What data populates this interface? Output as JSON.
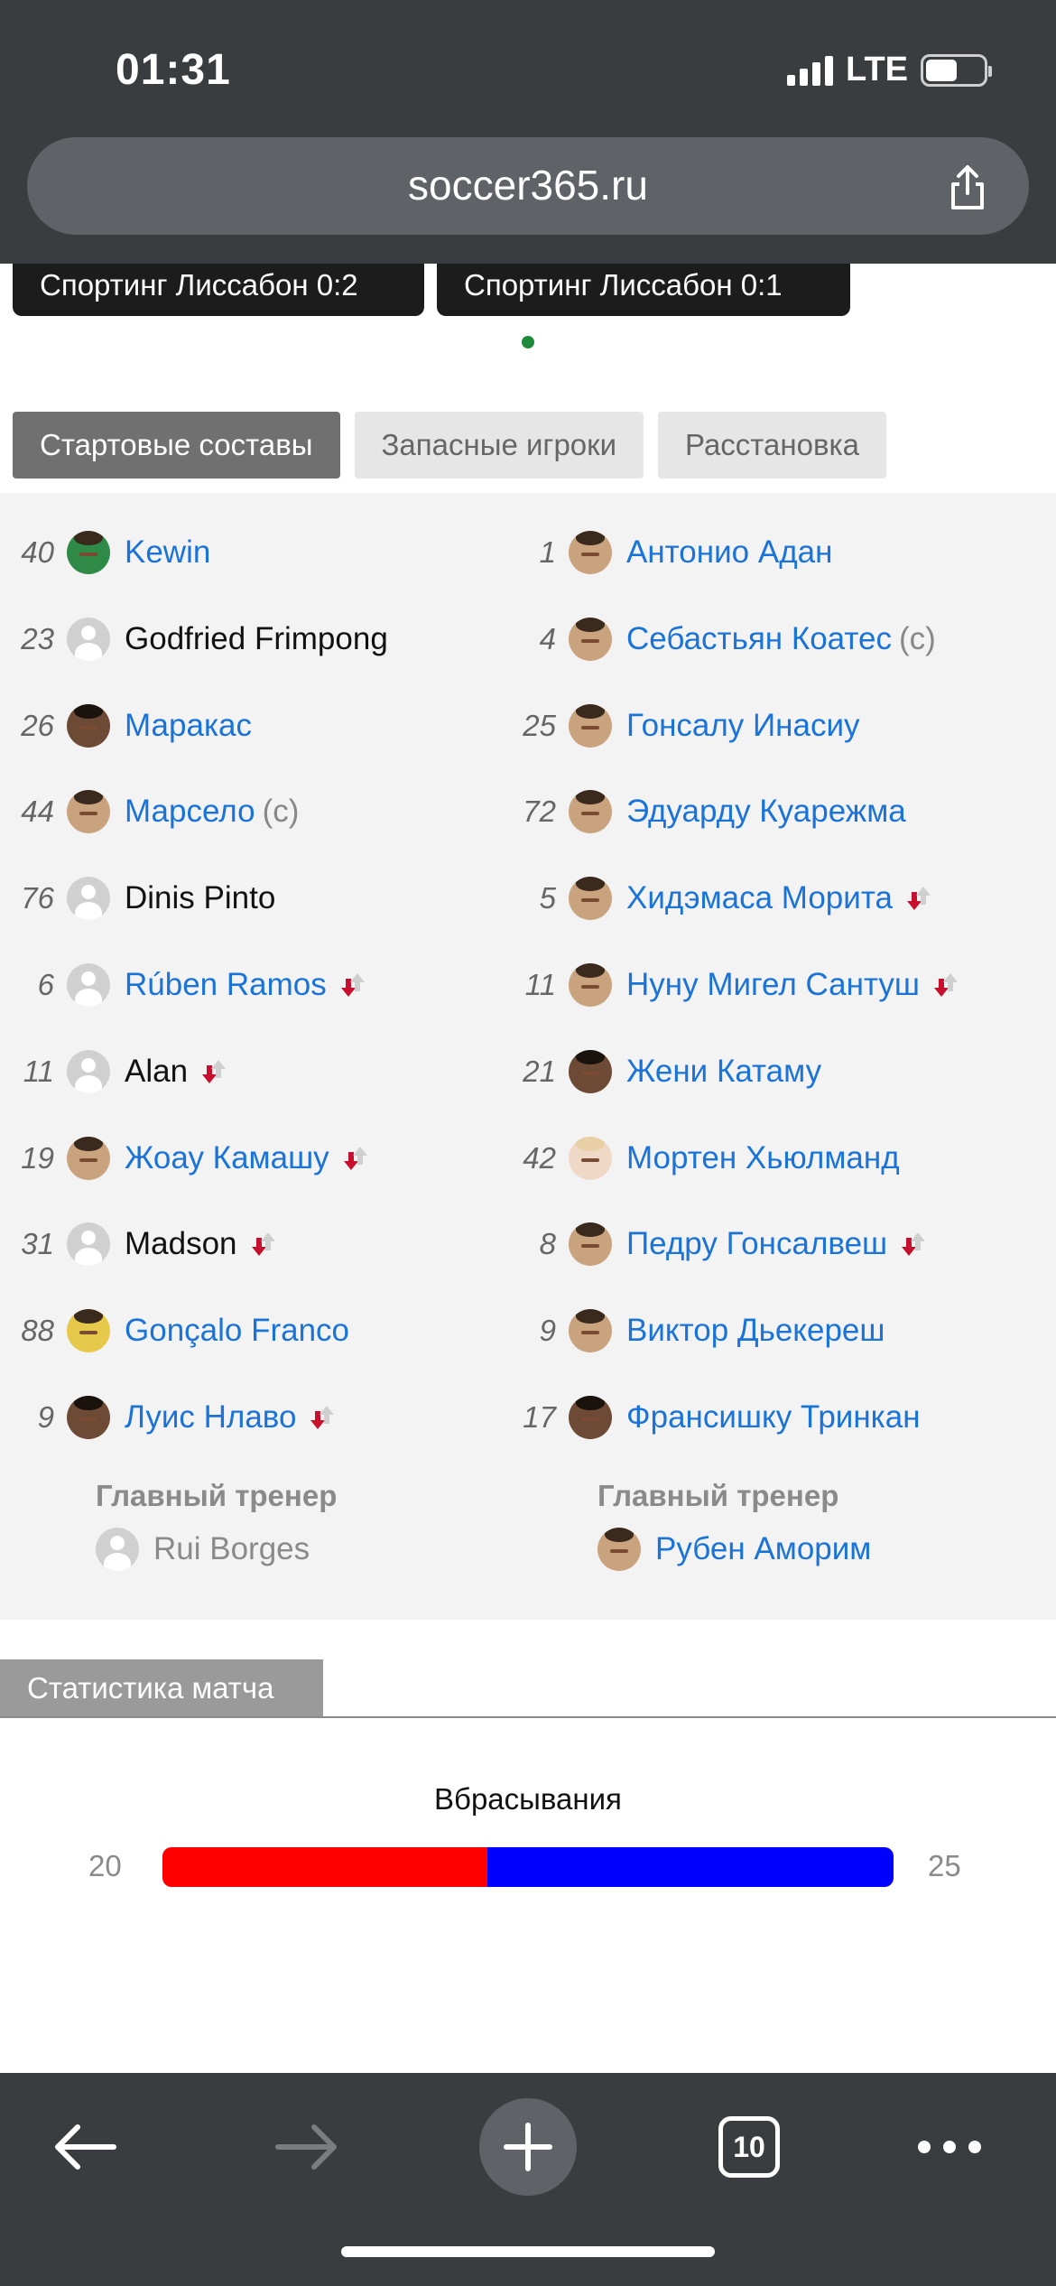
{
  "status": {
    "time": "01:31",
    "network": "LTE"
  },
  "browser": {
    "url": "soccer365.ru",
    "tabs_count": "10"
  },
  "news": [
    {
      "title": "Спортинг Лиссабон 0:2"
    },
    {
      "title": "Спортинг Лиссабон 0:1"
    }
  ],
  "tabs": [
    {
      "label": "Стартовые составы",
      "active": true
    },
    {
      "label": "Запасные игроки",
      "active": false
    },
    {
      "label": "Расстановка",
      "active": false
    }
  ],
  "lineups": {
    "home": {
      "players": [
        {
          "number": "40",
          "name": "Kewin",
          "link": true,
          "captain": "",
          "subbed": false,
          "avatar": "kit-green"
        },
        {
          "number": "23",
          "name": "Godfried Frimpong",
          "link": false,
          "captain": "",
          "subbed": false,
          "avatar": "generic"
        },
        {
          "number": "26",
          "name": "Маракас",
          "link": true,
          "captain": "",
          "subbed": false,
          "avatar": "dark"
        },
        {
          "number": "44",
          "name": "Марсело",
          "link": true,
          "captain": "(c)",
          "subbed": false,
          "avatar": "photo"
        },
        {
          "number": "76",
          "name": "Dinis Pinto",
          "link": false,
          "captain": "",
          "subbed": false,
          "avatar": "generic"
        },
        {
          "number": "6",
          "name": "Rúben Ramos",
          "link": true,
          "captain": "",
          "subbed": true,
          "avatar": "generic"
        },
        {
          "number": "11",
          "name": "Alan",
          "link": false,
          "captain": "",
          "subbed": true,
          "avatar": "generic"
        },
        {
          "number": "19",
          "name": "Жоау Камашу",
          "link": true,
          "captain": "",
          "subbed": true,
          "avatar": "photo"
        },
        {
          "number": "31",
          "name": "Madson",
          "link": false,
          "captain": "",
          "subbed": true,
          "avatar": "generic"
        },
        {
          "number": "88",
          "name": "Gonçalo Franco",
          "link": true,
          "captain": "",
          "subbed": false,
          "avatar": "kit-yellow"
        },
        {
          "number": "9",
          "name": "Луис Нлаво",
          "link": true,
          "captain": "",
          "subbed": true,
          "avatar": "dark"
        }
      ],
      "coach_label": "Главный тренер",
      "coach": {
        "name": "Rui Borges",
        "link": false,
        "avatar": "generic"
      }
    },
    "away": {
      "players": [
        {
          "number": "1",
          "name": "Антонио Адан",
          "link": true,
          "captain": "",
          "subbed": false,
          "avatar": "photo"
        },
        {
          "number": "4",
          "name": "Себастьян Коатес",
          "link": true,
          "captain": "(c)",
          "subbed": false,
          "avatar": "photo"
        },
        {
          "number": "25",
          "name": "Гонсалу Инасиу",
          "link": true,
          "captain": "",
          "subbed": false,
          "avatar": "photo"
        },
        {
          "number": "72",
          "name": "Эдуарду Куарежма",
          "link": true,
          "captain": "",
          "subbed": false,
          "avatar": "photo"
        },
        {
          "number": "5",
          "name": "Хидэмаса Морита",
          "link": true,
          "captain": "",
          "subbed": true,
          "avatar": "photo"
        },
        {
          "number": "11",
          "name": "Нуну Мигел Сантуш",
          "link": true,
          "captain": "",
          "subbed": true,
          "avatar": "photo"
        },
        {
          "number": "21",
          "name": "Жени Катаму",
          "link": true,
          "captain": "",
          "subbed": false,
          "avatar": "dark"
        },
        {
          "number": "42",
          "name": "Мортен Хьюлманд",
          "link": true,
          "captain": "",
          "subbed": false,
          "avatar": "pale"
        },
        {
          "number": "8",
          "name": "Педру Гонсалвеш",
          "link": true,
          "captain": "",
          "subbed": true,
          "avatar": "photo"
        },
        {
          "number": "9",
          "name": "Виктор Дьекереш",
          "link": true,
          "captain": "",
          "subbed": false,
          "avatar": "photo"
        },
        {
          "number": "17",
          "name": "Франсишку Тринкан",
          "link": true,
          "captain": "",
          "subbed": false,
          "avatar": "dark"
        }
      ],
      "coach_label": "Главный тренер",
      "coach": {
        "name": "Рубен Аморим",
        "link": true,
        "avatar": "photo"
      }
    }
  },
  "stats": {
    "tab_label": "Статистика матча",
    "items": [
      {
        "title": "Вбрасывания",
        "home": 20,
        "away": 25
      }
    ]
  },
  "colors": {
    "link": "#1a73d9",
    "home_bar": "#ff0000",
    "away_bar": "#0000ff",
    "chrome": "#3a3d40"
  },
  "icons": {
    "back": "arrow-left-icon",
    "forward": "arrow-right-icon",
    "new_tab": "plus-icon",
    "tabs": "tabs-count-icon",
    "menu": "more-dots-icon",
    "share": "share-icon",
    "substitution": "substitution-arrows-icon"
  }
}
